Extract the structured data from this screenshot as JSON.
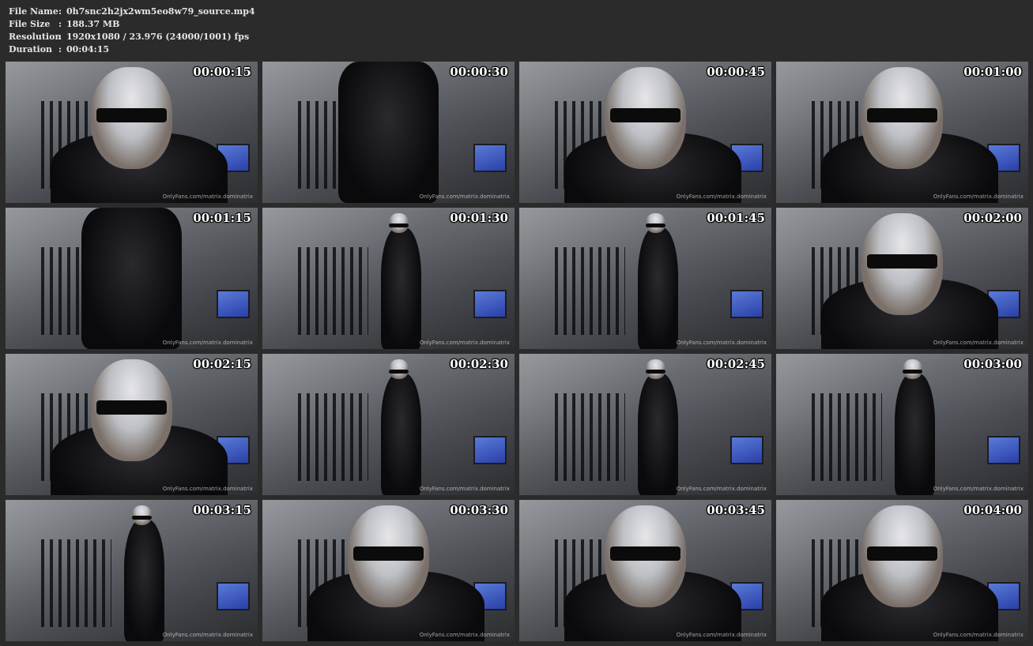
{
  "info": {
    "rows": [
      {
        "key": "File Name",
        "sep": ":",
        "value": "0h7snc2h2jx2wm5eo8w79_source.mp4"
      },
      {
        "key": "File Size",
        "sep": ":",
        "value": "188.37 MB"
      },
      {
        "key": "Resolution",
        "sep": ":",
        "value": "1920x1080 / 23.976 (24000/1001) fps"
      },
      {
        "key": "Duration",
        "sep": ":",
        "value": "00:04:15"
      }
    ]
  },
  "watermark": "OnlyFans.com/matrix.dominatrix",
  "thumbnails": [
    {
      "time": "00:00:15"
    },
    {
      "time": "00:00:30"
    },
    {
      "time": "00:00:45"
    },
    {
      "time": "00:01:00"
    },
    {
      "time": "00:01:15"
    },
    {
      "time": "00:01:30"
    },
    {
      "time": "00:01:45"
    },
    {
      "time": "00:02:00"
    },
    {
      "time": "00:02:15"
    },
    {
      "time": "00:02:30"
    },
    {
      "time": "00:02:45"
    },
    {
      "time": "00:03:00"
    },
    {
      "time": "00:03:15"
    },
    {
      "time": "00:03:30"
    },
    {
      "time": "00:03:45"
    },
    {
      "time": "00:04:00"
    }
  ]
}
